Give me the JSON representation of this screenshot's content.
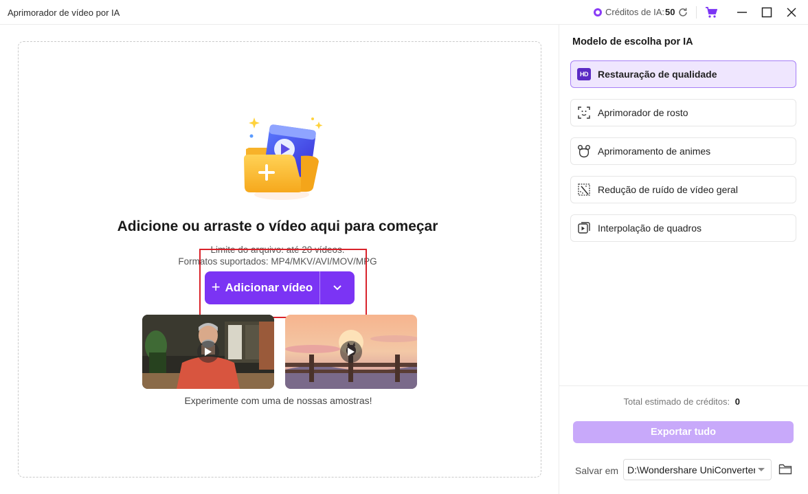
{
  "titlebar": {
    "app_title": "Aprimorador de vídeo por IA",
    "credits_label": "Créditos de IA:",
    "credits_value": "50",
    "icons": [
      "coin-icon",
      "refresh-icon",
      "cart-icon",
      "minimize-icon",
      "maximize-icon",
      "close-icon"
    ]
  },
  "dropzone": {
    "headline": "Adicione ou arraste o vídeo aqui para começar",
    "limit_text": "Limite do arquivo: até 20 vídeos.",
    "formats_text": "Formatos suportados: MP4/MKV/AVI/MOV/MPG",
    "add_button_label": "Adicionar vídeo",
    "samples_caption": "Experimente com uma de nossas amostras!"
  },
  "panel": {
    "title": "Modelo de escolha por IA",
    "models": [
      {
        "label": "Restauração de qualidade",
        "icon": "hd-icon",
        "selected": true
      },
      {
        "label": "Aprimorador de rosto",
        "icon": "face-scan-icon",
        "selected": false
      },
      {
        "label": "Aprimoramento de animes",
        "icon": "anime-bear-icon",
        "selected": false
      },
      {
        "label": "Redução de ruído de vídeo geral",
        "icon": "denoise-icon",
        "selected": false
      },
      {
        "label": "Interpolação de quadros",
        "icon": "frame-interpolation-icon",
        "selected": false
      }
    ],
    "total_label": "Total estimado de créditos:",
    "total_value": "0",
    "export_label": "Exportar tudo",
    "save_label": "Salvar em",
    "save_path": "D:\\Wondershare UniConverter"
  },
  "colors": {
    "accent": "#7b34f4",
    "selected_bg": "#efe6fe",
    "export_disabled": "#c8a9fa",
    "highlight": "#d9222a"
  }
}
